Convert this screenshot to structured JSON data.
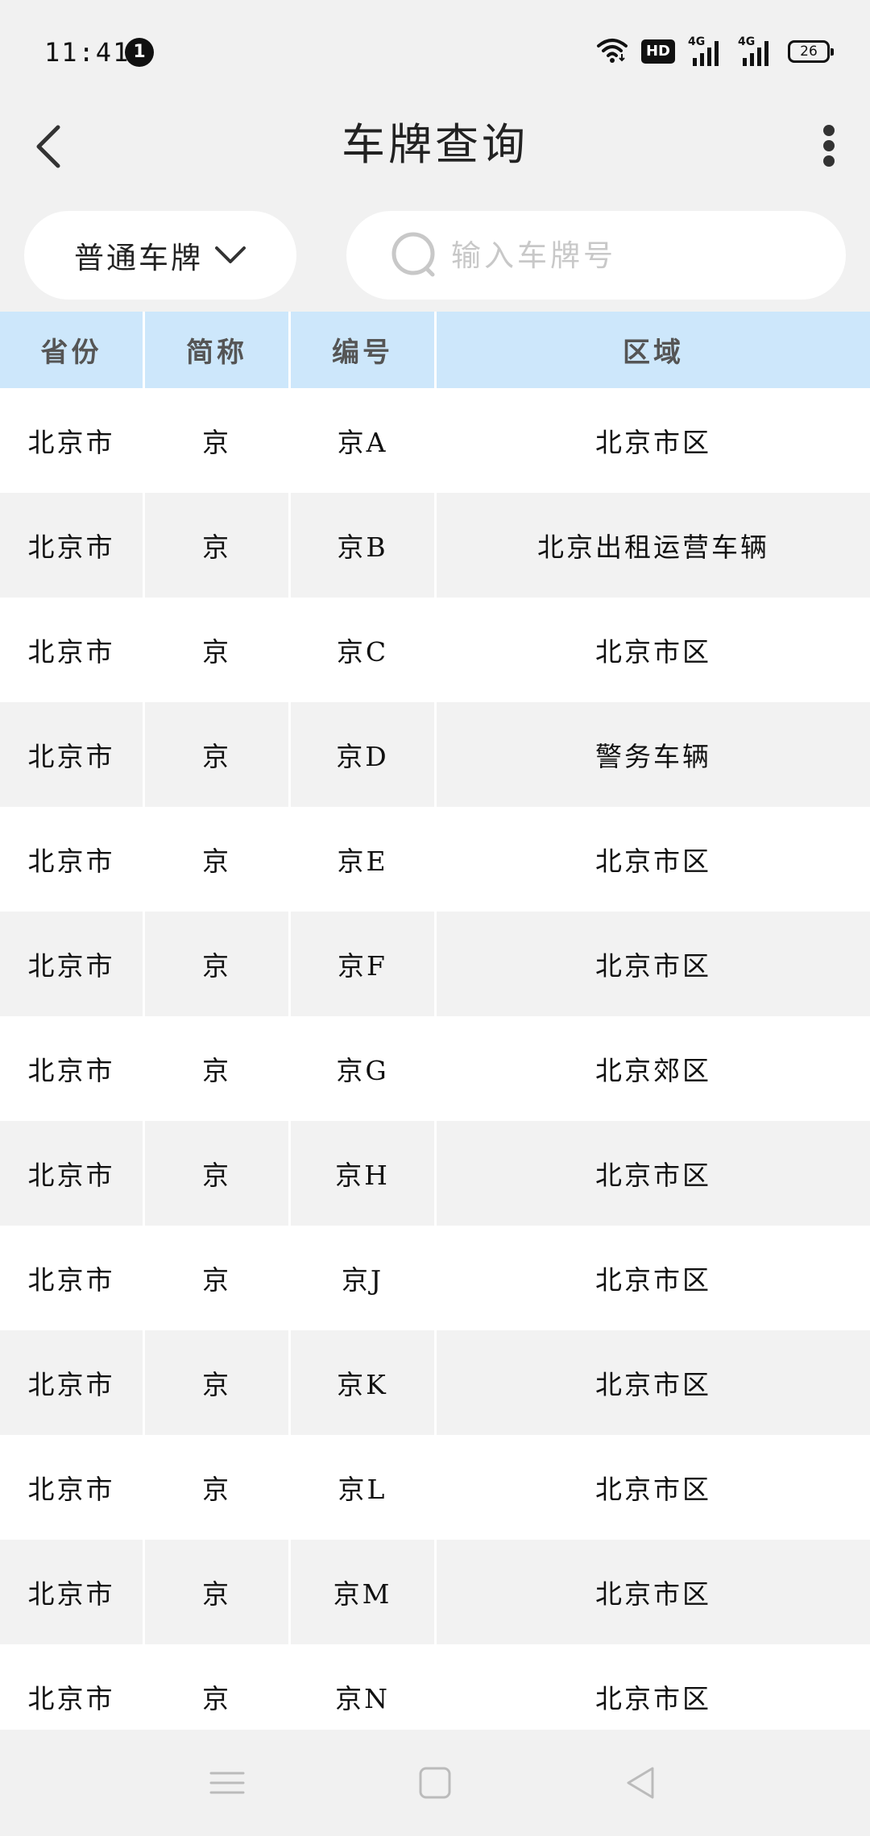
{
  "status_bar": {
    "time": "11:41",
    "notification_count": "1",
    "hd_label": "HD",
    "signal1_label": "4G",
    "signal2_label": "4G",
    "battery_level": "26"
  },
  "header": {
    "title": "车牌查询"
  },
  "filter": {
    "plate_type": "普通车牌",
    "search_placeholder": "输入车牌号",
    "search_value": ""
  },
  "table": {
    "columns": [
      "省份",
      "简称",
      "编号",
      "区域"
    ],
    "rows": [
      [
        "北京市",
        "京",
        "京A",
        "北京市区"
      ],
      [
        "北京市",
        "京",
        "京B",
        "北京出租运营车辆"
      ],
      [
        "北京市",
        "京",
        "京C",
        "北京市区"
      ],
      [
        "北京市",
        "京",
        "京D",
        "警务车辆"
      ],
      [
        "北京市",
        "京",
        "京E",
        "北京市区"
      ],
      [
        "北京市",
        "京",
        "京F",
        "北京市区"
      ],
      [
        "北京市",
        "京",
        "京G",
        "北京郊区"
      ],
      [
        "北京市",
        "京",
        "京H",
        "北京市区"
      ],
      [
        "北京市",
        "京",
        "京J",
        "北京市区"
      ],
      [
        "北京市",
        "京",
        "京K",
        "北京市区"
      ],
      [
        "北京市",
        "京",
        "京L",
        "北京市区"
      ],
      [
        "北京市",
        "京",
        "京M",
        "北京市区"
      ],
      [
        "北京市",
        "京",
        "京N",
        "北京市区"
      ]
    ]
  },
  "nav": {
    "icons": [
      "menu-icon",
      "home-icon",
      "back-triangle-icon"
    ]
  },
  "colors": {
    "header_bg": "#cde7fb",
    "page_bg": "#f1f1f1",
    "row_alt": "#f2f2f2"
  }
}
